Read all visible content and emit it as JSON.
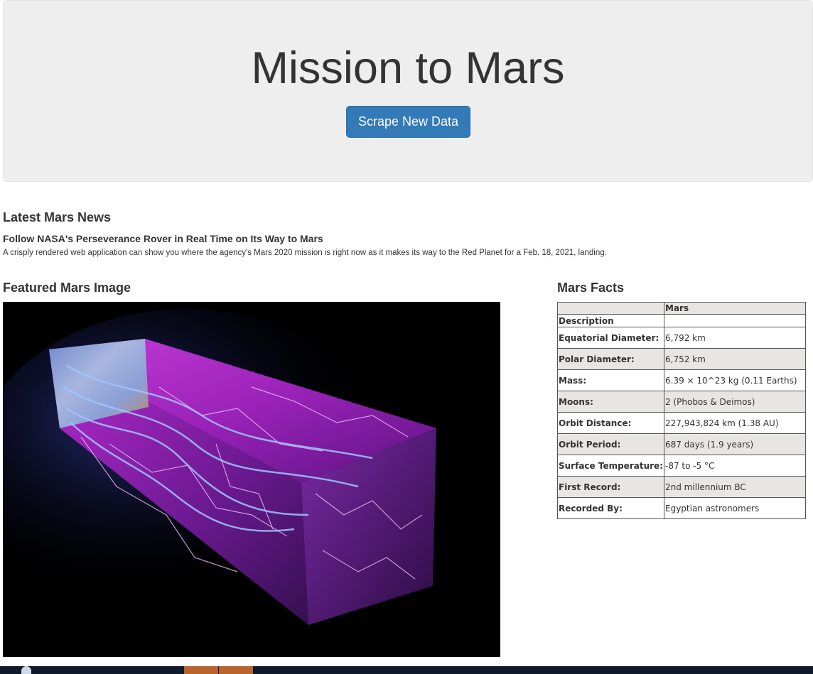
{
  "header": {
    "title": "Mission to Mars",
    "scrape_button": "Scrape New Data"
  },
  "news": {
    "heading": "Latest Mars News",
    "title": "Follow NASA's Perseverance Rover in Real Time on Its Way to Mars",
    "teaser": "A crisply rendered web application can show you where the agency's Mars 2020 mission is right now as it makes its way to the Red Planet for a Feb. 18, 2021, landing."
  },
  "featured_image": {
    "heading": "Featured Mars Image"
  },
  "facts": {
    "heading": "Mars Facts",
    "column_header": "Mars",
    "description_label": "Description",
    "rows": [
      {
        "label": "Equatorial Diameter:",
        "value": "6,792 km"
      },
      {
        "label": "Polar Diameter:",
        "value": "6,752 km"
      },
      {
        "label": "Mass:",
        "value": "6.39 × 10^23 kg (0.11 Earths)"
      },
      {
        "label": "Moons:",
        "value": "2 (Phobos & Deimos)"
      },
      {
        "label": "Orbit Distance:",
        "value": "227,943,824 km (1.38 AU)"
      },
      {
        "label": "Orbit Period:",
        "value": "687 days (1.9 years)"
      },
      {
        "label": "Surface Temperature:",
        "value": "-87 to -5 °C"
      },
      {
        "label": "First Record:",
        "value": "2nd millennium BC"
      },
      {
        "label": "Recorded By:",
        "value": "Egyptian astronomers"
      }
    ]
  },
  "colors": {
    "jumbotron_bg": "#eeeeee",
    "button_primary": "#337ab7",
    "table_stripe": "#e8e6e5"
  }
}
